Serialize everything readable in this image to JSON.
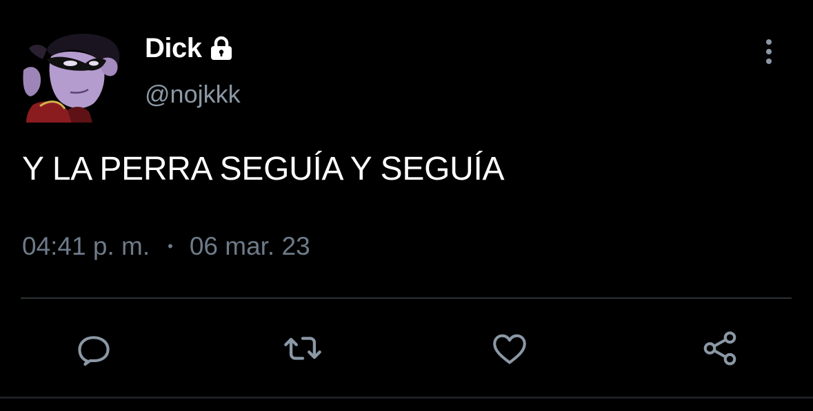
{
  "tweet": {
    "display_name": "Dick",
    "handle": "@nojkkk",
    "text": "Y LA PERRA SEGUÍA Y SEGUÍA",
    "time": "04:41 p. m.",
    "separator": "•",
    "date": "06 mar. 23",
    "protected": true
  },
  "icons": {
    "lock": "lock-icon",
    "more": "more-vertical-icon",
    "reply": "reply-icon",
    "retweet": "retweet-icon",
    "like": "heart-icon",
    "share": "share-icon"
  },
  "colors": {
    "background": "#000000",
    "primary_text": "#ffffff",
    "secondary_text": "#8b98a5",
    "icon": "#8b98a5",
    "divider": "#2f3336"
  }
}
